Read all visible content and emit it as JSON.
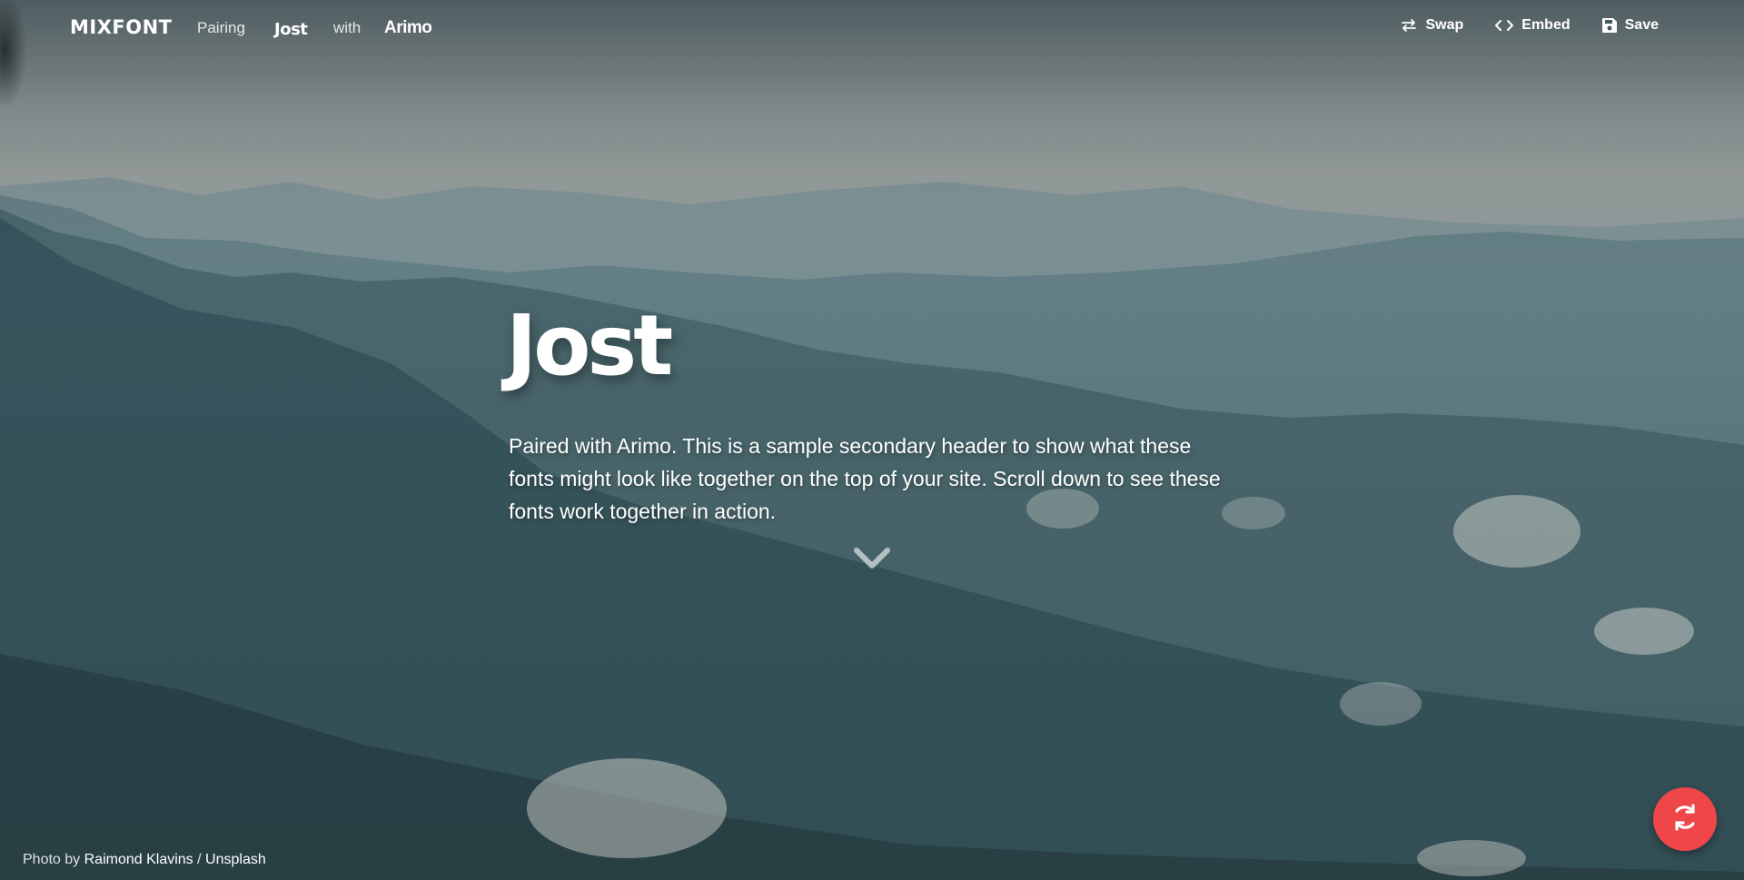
{
  "nav": {
    "brand": "MIXFONT",
    "pairing_label": "Pairing",
    "primary_font": "Jost",
    "with_label": "with",
    "secondary_font": "Arimo",
    "actions": [
      {
        "label": "Swap",
        "icon": "swap-icon"
      },
      {
        "label": "Embed",
        "icon": "code-icon"
      },
      {
        "label": "Save",
        "icon": "save-icon"
      }
    ]
  },
  "hero": {
    "title": "Jost",
    "subtitle": "Paired with Arimo. This is a sample secondary header to show what these fonts might look like together on the top of your site. Scroll down to see these fonts work together in action.",
    "scroll_icon": "chevron-down-icon"
  },
  "credit": {
    "prefix": "Photo by",
    "author": "Raimond Klavins",
    "separator": "/",
    "source": "Unsplash"
  },
  "fab": {
    "icon": "refresh-icon",
    "color": "#ef4649"
  }
}
